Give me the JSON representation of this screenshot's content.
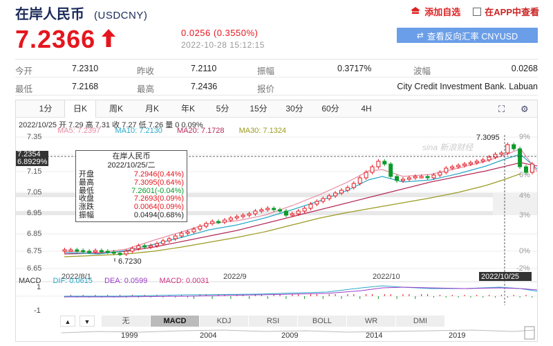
{
  "header": {
    "title": "在岸人民币",
    "code": "(USDCNY)",
    "add_fav": "添加自选",
    "view_app": "在APP中查看"
  },
  "quote": {
    "price": "7.2366",
    "change": "0.0256 (0.3550%)",
    "time": "2022-10-28 15:12:15",
    "reverse_button": "查看反向汇率 CNYUSD"
  },
  "stats": {
    "rows": [
      [
        {
          "label": "今开",
          "value": "7.2310"
        },
        {
          "label": "昨收",
          "value": "7.2110"
        },
        {
          "label": "振幅",
          "value": "0.3717%"
        },
        {
          "label": "波幅",
          "value": "0.0268"
        }
      ],
      [
        {
          "label": "最低",
          "value": "7.2168"
        },
        {
          "label": "最高",
          "value": "7.2436"
        },
        {
          "label": "报价",
          "value": "City Credit Investment Bank. Labuan"
        }
      ]
    ]
  },
  "chart": {
    "periods": [
      "1分",
      "日K",
      "周K",
      "月K",
      "年K",
      "5分",
      "15分",
      "30分",
      "60分",
      "4H"
    ],
    "active_period": "日K",
    "info_line": "2022/10/25 开 7.29 高 7.31 收 7.27 低 7.26 量 0 0.09%",
    "ma": [
      {
        "label": "MA5: 7.2397",
        "color": "#e88aa0"
      },
      {
        "label": "MA10: 7.2130",
        "color": "#2aa7c8"
      },
      {
        "label": "MA20: 7.1728",
        "color": "#b52a5a"
      },
      {
        "label": "MA30: 7.1324",
        "color": "#9a9a20"
      }
    ],
    "cur_price": "7.2354",
    "cur_pct": "6.8929%",
    "max_label": "7.3095",
    "min_label": "6.7230",
    "watermark": "sina 新浪财经",
    "yticks": [
      "7.35",
      "7.25",
      "7.15",
      "7.05",
      "6.95",
      "6.85",
      "6.75",
      "6.65"
    ],
    "pct_ticks": [
      "9%",
      "6%",
      "4%",
      "3%",
      "0%",
      "-2%"
    ],
    "xlabels": [
      "2022/8/1",
      "2022/9",
      "2022/10"
    ],
    "cursor_date": "2022/10/25",
    "tooltip": {
      "title": "在岸人民币",
      "date": "2022/10/25/二",
      "rows": [
        {
          "k": "开盘",
          "v": "7.2946(0.44%)",
          "c": "red"
        },
        {
          "k": "最高",
          "v": "7.3095(0.64%)",
          "c": "red"
        },
        {
          "k": "最低",
          "v": "7.2601(-0.04%)",
          "c": "green"
        },
        {
          "k": "收盘",
          "v": "7.2693(0.09%)",
          "c": "red"
        },
        {
          "k": "涨跌",
          "v": "0.0064(0.09%)",
          "c": "red"
        },
        {
          "k": "振幅",
          "v": "0.0494(0.68%)",
          "c": "black"
        }
      ]
    },
    "macd": {
      "label": "MACD",
      "dif": "DIF: 0.0615",
      "dea": "DEA: 0.0599",
      "macd": "MACD: 0.0031",
      "yticks": [
        "1",
        "-1"
      ]
    },
    "indicators": [
      "无",
      "MACD",
      "KDJ",
      "RSI",
      "BOLL",
      "WR",
      "DMI"
    ],
    "active_indicator": "MACD",
    "years": [
      "1999",
      "2004",
      "2009",
      "2014",
      "2019"
    ]
  }
}
